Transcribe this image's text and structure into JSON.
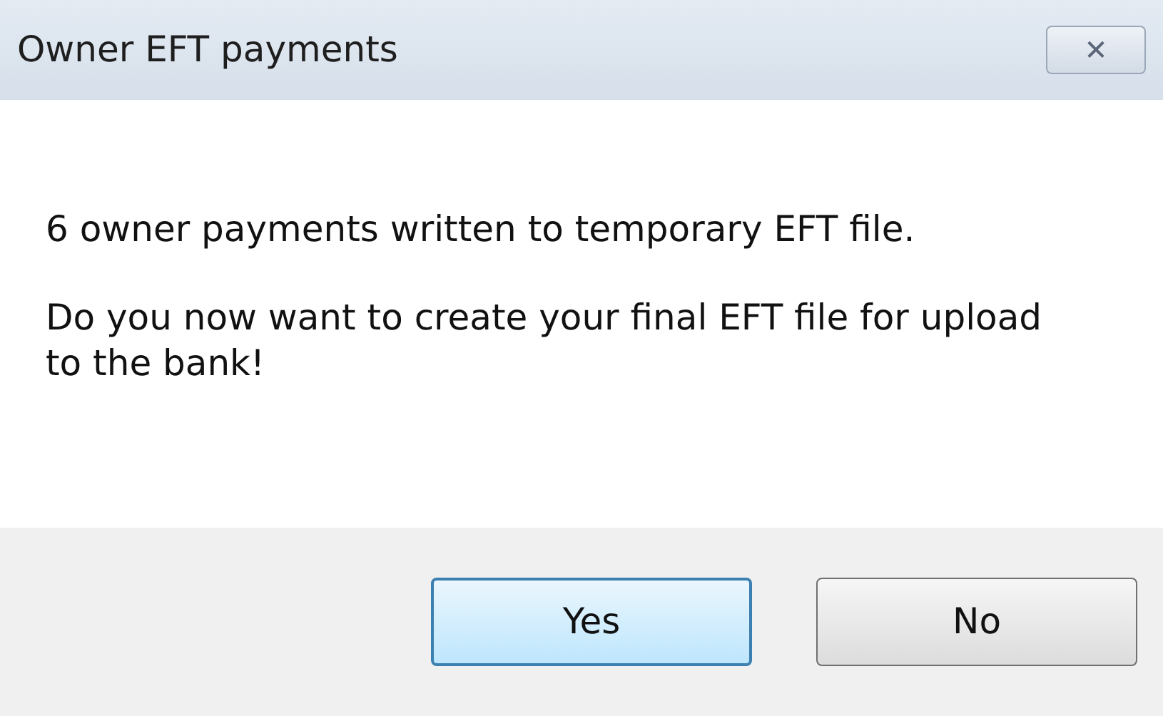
{
  "window": {
    "title": "Owner EFT payments",
    "close": "✕"
  },
  "message": [
    "6 owner payments written to temporary EFT file.",
    "Do you now want to create your final EFT file for upload to the bank!"
  ],
  "buttons": [
    {
      "label": "Yes",
      "default": true
    },
    {
      "label": "No",
      "default": false
    }
  ]
}
